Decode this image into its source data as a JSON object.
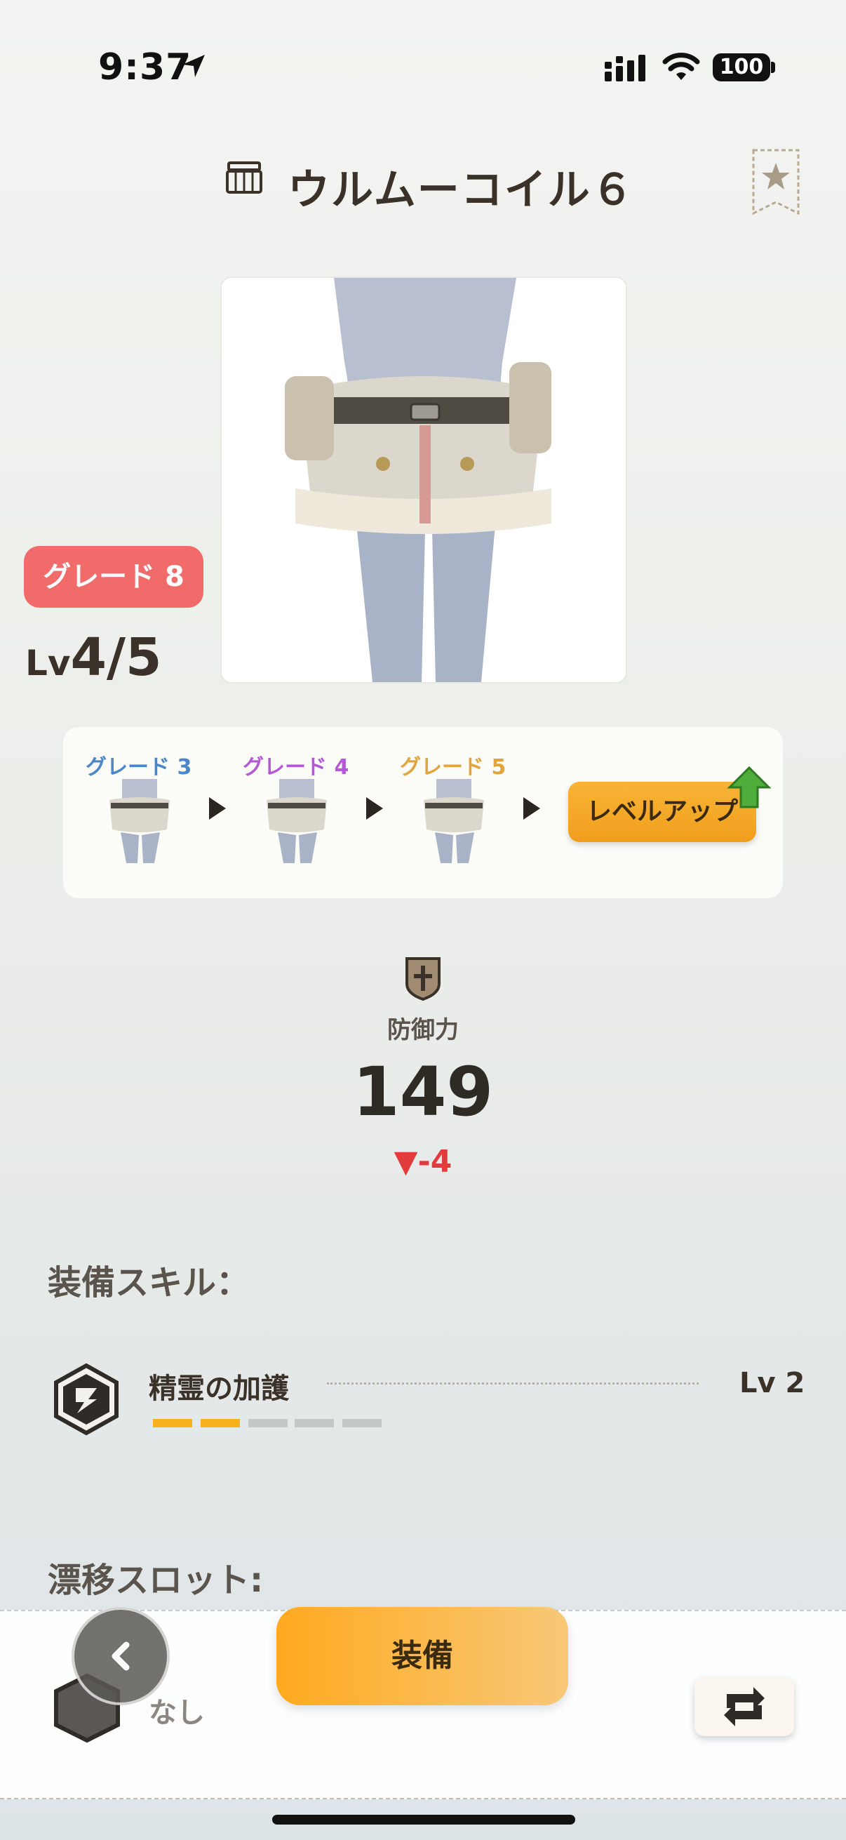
{
  "status_bar": {
    "time": "9:37",
    "battery": "100"
  },
  "header": {
    "title": "ウルムーコイル６"
  },
  "item": {
    "grade_badge": "グレード 8",
    "level_prefix": "Lv",
    "level_value": "4/5"
  },
  "progression": {
    "grades": [
      {
        "label": "グレード 3",
        "color": "#4a86c8"
      },
      {
        "label": "グレード 4",
        "color": "#b359d6"
      },
      {
        "label": "グレード 5",
        "color": "#e0a53c"
      }
    ],
    "level_up_label": "レベルアップ"
  },
  "defense": {
    "label": "防御力",
    "value": "149",
    "diff": "▼-4"
  },
  "skills": {
    "title": "装備スキル：",
    "items": [
      {
        "name": "精霊の加護",
        "level": "Lv 2",
        "filled": 2,
        "total": 5
      }
    ]
  },
  "drift_slot": {
    "title": "漂移スロット:",
    "value": "なし"
  },
  "actions": {
    "equip_label": "装備"
  },
  "colors": {
    "accent": "#f8a81f",
    "grade_badge": "#f26b6b",
    "negative": "#e23b3b"
  }
}
